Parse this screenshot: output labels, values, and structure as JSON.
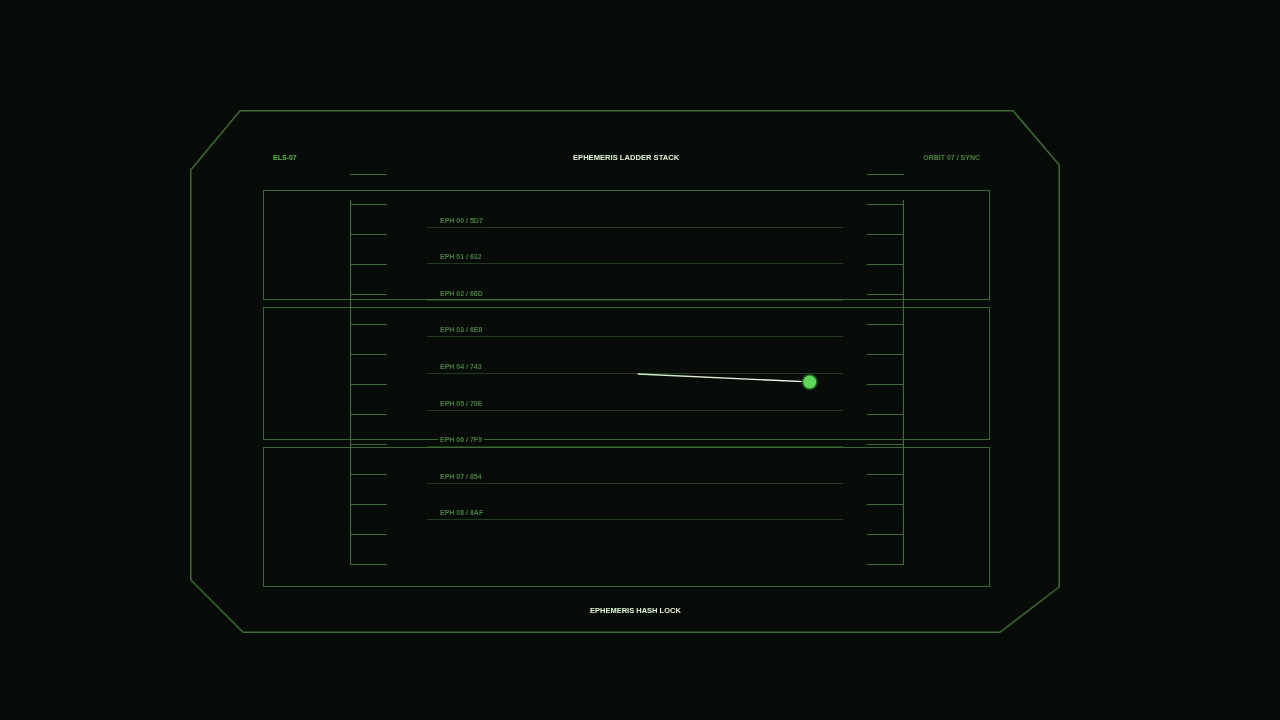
{
  "header": {
    "code": "ELS-07",
    "title": "EPHEMERIS LADDER STACK",
    "status": "ORBIT 07 / SYNC"
  },
  "ladder": {
    "rungs": [
      "EPH 00 / 5D7",
      "EPH 01 / 632",
      "EPH 02 / 68D",
      "EPH 03 / 6E8",
      "EPH 04 / 743",
      "EPH 05 / 79E",
      "EPH 06 / 7F9",
      "EPH 07 / 854",
      "EPH 08 / 8AF"
    ]
  },
  "tracker": {
    "level": 0.92
  },
  "footer": {
    "label": "EPHEMERIS HASH LOCK"
  }
}
